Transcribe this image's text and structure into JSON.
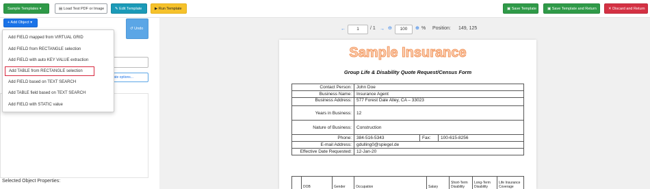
{
  "toolbar": {
    "sample_templates": "Sample Templates",
    "load_test_pdf": "Load Test PDF or Image",
    "edit_template": "Edit Template",
    "run_template": "Run Template",
    "save_template": "Save Template",
    "save_template_return": "Save Template and Return",
    "discard_return": "Discard and Return"
  },
  "left": {
    "add_object": "+ Add Object",
    "undo": "Undo",
    "template_options": "Template options...",
    "selected_props": "Selected Object Properties:"
  },
  "dropdown": {
    "items": [
      "Add FIELD mapped from VIRTUAL GRID",
      "Add FIELD from RECTANGLE selection",
      "Add FIELD with auto KEY VALUE extraction",
      "Add TABLE from RECTANGLE selection",
      "Add FIELD based on TEXT SEARCH",
      "Add TABLE field based on TEXT SEARCH",
      "Add FIELD with STATIC value"
    ]
  },
  "viewer": {
    "page": "1",
    "page_total": "/ 1",
    "zoom": "100",
    "percent": "%",
    "position_label": "Position:",
    "position_value": "149, 125"
  },
  "document": {
    "title": "Sample Insurance",
    "subtitle": "Group Life & Disability Quote Request/Census Form",
    "fields": {
      "contact_person_label": "Contact Person:",
      "contact_person": "John Doe",
      "business_name_label": "Business Name:",
      "business_name": "Insurance Agent",
      "business_address_label": "Business Address:",
      "business_address": "577 Forest Dale Alley, CA – 33023",
      "years_label": "Years in Business:",
      "years": "12",
      "nature_label": "Nature of Business:",
      "nature": "Construction",
      "phone_label": "Phone:",
      "phone": "384-516-5343",
      "fax_label": "Fax:",
      "fax": "100-615-8256",
      "email_label": "E-mail Address:",
      "email": "gdulling0@spiegel.de",
      "effective_label": "Effective Date Requested:",
      "effective": "12-Jan-20"
    },
    "census_headers": [
      "DOB",
      "Gender",
      "Occupation",
      "Salary",
      "Short-Term Disability",
      "Long-Term Disability",
      "Life Insurance Coverage"
    ]
  },
  "colors": {
    "green": "#2f9a48",
    "teal": "#1b9ab8",
    "yellow": "#f6c22b",
    "red": "#d43143",
    "blue": "#1a73e8",
    "highlight": "#d7263d"
  }
}
